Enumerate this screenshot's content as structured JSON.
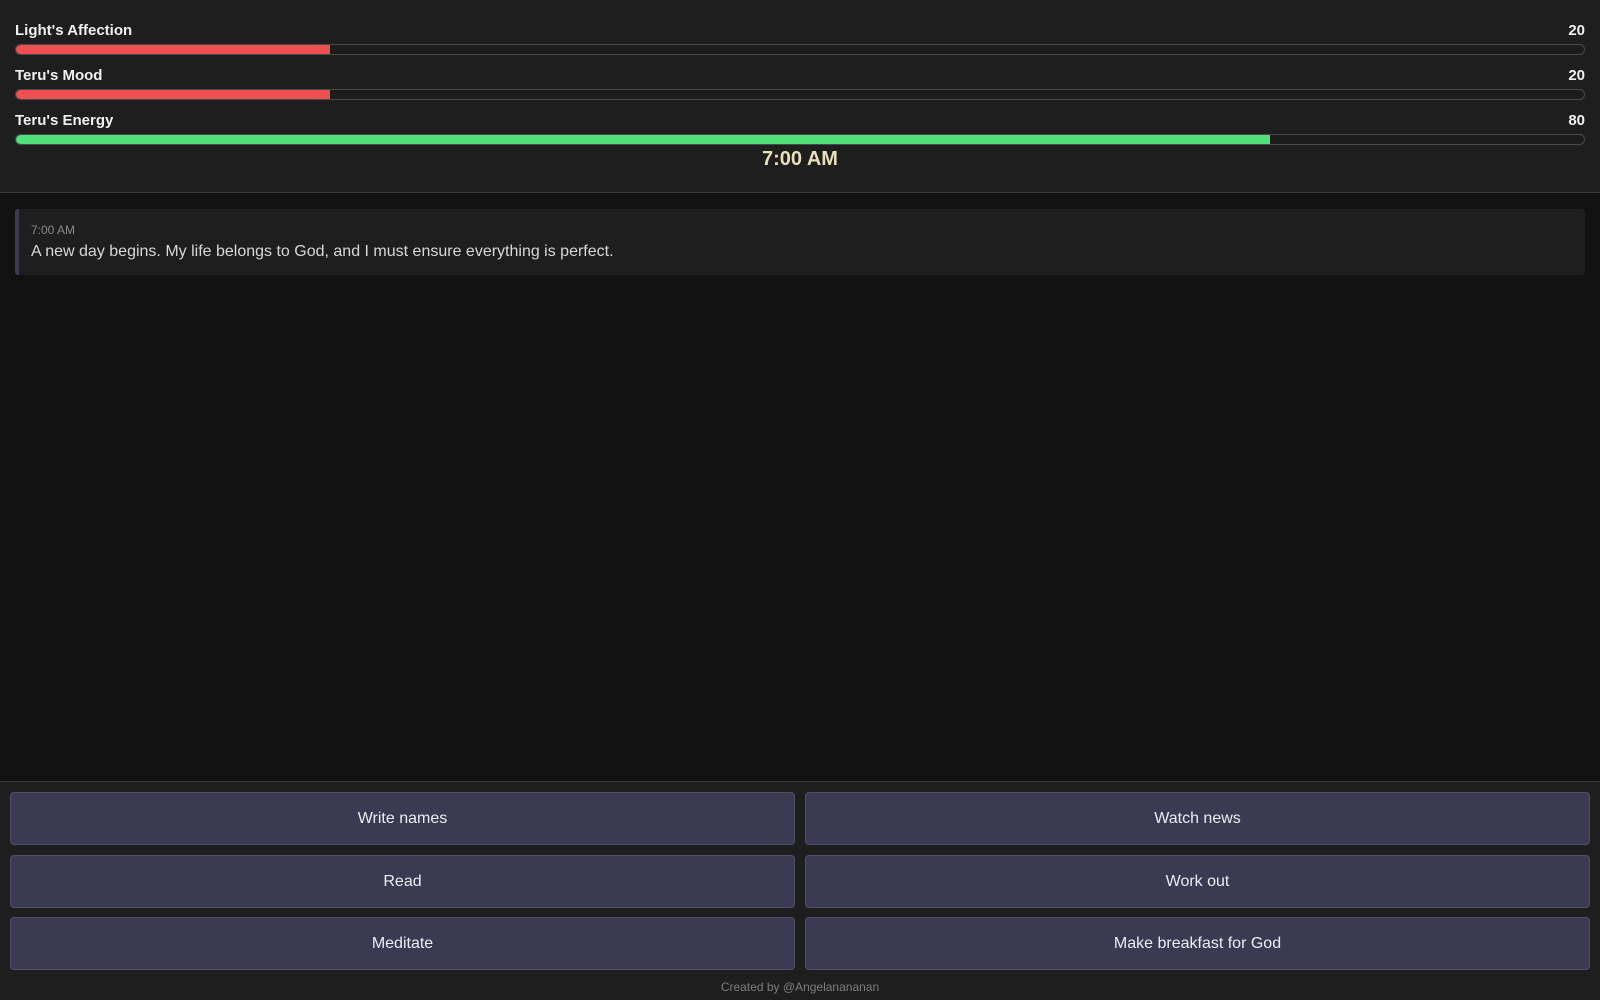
{
  "stats": [
    {
      "label": "Light's Affection",
      "value": 20,
      "display": "20",
      "fraction": 0.2,
      "color": "#f05050"
    },
    {
      "label": "Teru's Mood",
      "value": 20,
      "display": "20",
      "fraction": 0.2,
      "color": "#f05050"
    },
    {
      "label": "Teru's Energy",
      "value": 80,
      "display": "80",
      "fraction": 0.8,
      "color": "#4fe07a"
    }
  ],
  "clock": {
    "time": "7:00 AM"
  },
  "log": [
    {
      "time": "7:00 AM",
      "text": "A new day begins. My life belongs to God, and I must ensure everything is perfect."
    }
  ],
  "actions": [
    {
      "label": "Write names"
    },
    {
      "label": "Watch news"
    },
    {
      "label": "Read"
    },
    {
      "label": "Work out"
    },
    {
      "label": "Meditate"
    },
    {
      "label": "Make breakfast for God"
    }
  ],
  "footer": {
    "credit": "Created by @Angelanananan"
  }
}
